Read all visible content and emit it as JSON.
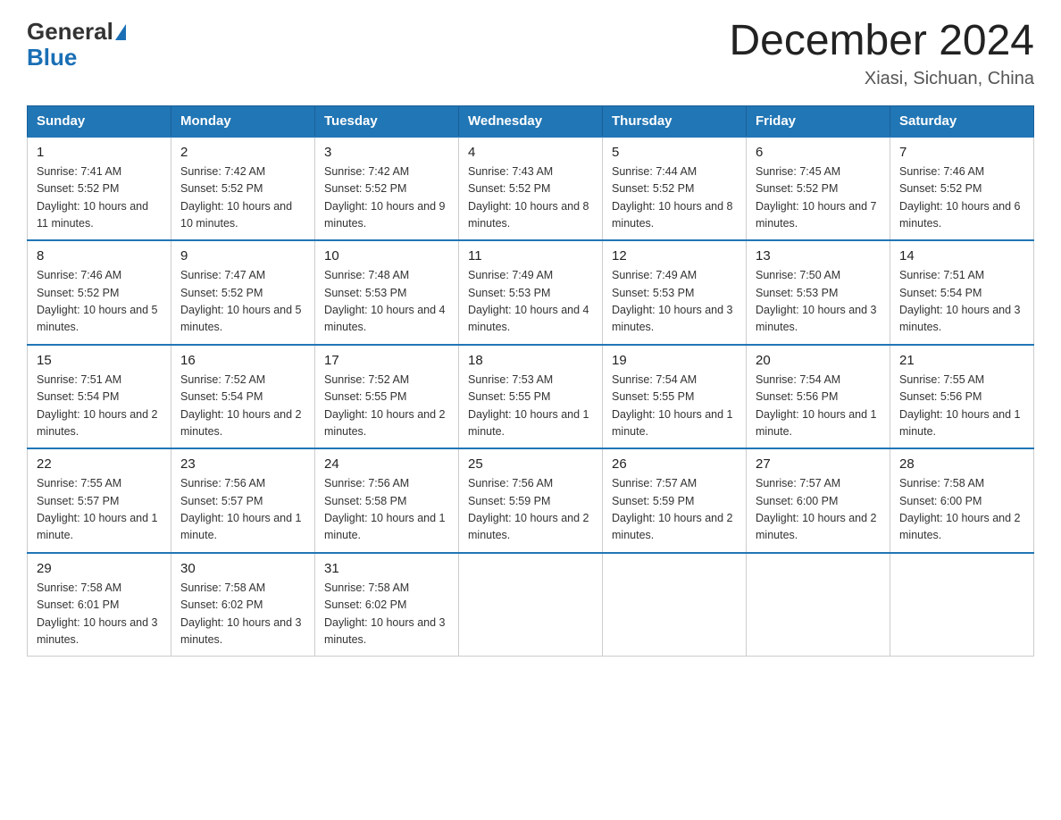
{
  "header": {
    "logo_general": "General",
    "logo_blue": "Blue",
    "month_year": "December 2024",
    "location": "Xiasi, Sichuan, China"
  },
  "weekdays": [
    "Sunday",
    "Monday",
    "Tuesday",
    "Wednesday",
    "Thursday",
    "Friday",
    "Saturday"
  ],
  "weeks": [
    [
      {
        "day": "1",
        "sunrise": "7:41 AM",
        "sunset": "5:52 PM",
        "daylight": "10 hours and 11 minutes."
      },
      {
        "day": "2",
        "sunrise": "7:42 AM",
        "sunset": "5:52 PM",
        "daylight": "10 hours and 10 minutes."
      },
      {
        "day": "3",
        "sunrise": "7:42 AM",
        "sunset": "5:52 PM",
        "daylight": "10 hours and 9 minutes."
      },
      {
        "day": "4",
        "sunrise": "7:43 AM",
        "sunset": "5:52 PM",
        "daylight": "10 hours and 8 minutes."
      },
      {
        "day": "5",
        "sunrise": "7:44 AM",
        "sunset": "5:52 PM",
        "daylight": "10 hours and 8 minutes."
      },
      {
        "day": "6",
        "sunrise": "7:45 AM",
        "sunset": "5:52 PM",
        "daylight": "10 hours and 7 minutes."
      },
      {
        "day": "7",
        "sunrise": "7:46 AM",
        "sunset": "5:52 PM",
        "daylight": "10 hours and 6 minutes."
      }
    ],
    [
      {
        "day": "8",
        "sunrise": "7:46 AM",
        "sunset": "5:52 PM",
        "daylight": "10 hours and 5 minutes."
      },
      {
        "day": "9",
        "sunrise": "7:47 AM",
        "sunset": "5:52 PM",
        "daylight": "10 hours and 5 minutes."
      },
      {
        "day": "10",
        "sunrise": "7:48 AM",
        "sunset": "5:53 PM",
        "daylight": "10 hours and 4 minutes."
      },
      {
        "day": "11",
        "sunrise": "7:49 AM",
        "sunset": "5:53 PM",
        "daylight": "10 hours and 4 minutes."
      },
      {
        "day": "12",
        "sunrise": "7:49 AM",
        "sunset": "5:53 PM",
        "daylight": "10 hours and 3 minutes."
      },
      {
        "day": "13",
        "sunrise": "7:50 AM",
        "sunset": "5:53 PM",
        "daylight": "10 hours and 3 minutes."
      },
      {
        "day": "14",
        "sunrise": "7:51 AM",
        "sunset": "5:54 PM",
        "daylight": "10 hours and 3 minutes."
      }
    ],
    [
      {
        "day": "15",
        "sunrise": "7:51 AM",
        "sunset": "5:54 PM",
        "daylight": "10 hours and 2 minutes."
      },
      {
        "day": "16",
        "sunrise": "7:52 AM",
        "sunset": "5:54 PM",
        "daylight": "10 hours and 2 minutes."
      },
      {
        "day": "17",
        "sunrise": "7:52 AM",
        "sunset": "5:55 PM",
        "daylight": "10 hours and 2 minutes."
      },
      {
        "day": "18",
        "sunrise": "7:53 AM",
        "sunset": "5:55 PM",
        "daylight": "10 hours and 1 minute."
      },
      {
        "day": "19",
        "sunrise": "7:54 AM",
        "sunset": "5:55 PM",
        "daylight": "10 hours and 1 minute."
      },
      {
        "day": "20",
        "sunrise": "7:54 AM",
        "sunset": "5:56 PM",
        "daylight": "10 hours and 1 minute."
      },
      {
        "day": "21",
        "sunrise": "7:55 AM",
        "sunset": "5:56 PM",
        "daylight": "10 hours and 1 minute."
      }
    ],
    [
      {
        "day": "22",
        "sunrise": "7:55 AM",
        "sunset": "5:57 PM",
        "daylight": "10 hours and 1 minute."
      },
      {
        "day": "23",
        "sunrise": "7:56 AM",
        "sunset": "5:57 PM",
        "daylight": "10 hours and 1 minute."
      },
      {
        "day": "24",
        "sunrise": "7:56 AM",
        "sunset": "5:58 PM",
        "daylight": "10 hours and 1 minute."
      },
      {
        "day": "25",
        "sunrise": "7:56 AM",
        "sunset": "5:59 PM",
        "daylight": "10 hours and 2 minutes."
      },
      {
        "day": "26",
        "sunrise": "7:57 AM",
        "sunset": "5:59 PM",
        "daylight": "10 hours and 2 minutes."
      },
      {
        "day": "27",
        "sunrise": "7:57 AM",
        "sunset": "6:00 PM",
        "daylight": "10 hours and 2 minutes."
      },
      {
        "day": "28",
        "sunrise": "7:58 AM",
        "sunset": "6:00 PM",
        "daylight": "10 hours and 2 minutes."
      }
    ],
    [
      {
        "day": "29",
        "sunrise": "7:58 AM",
        "sunset": "6:01 PM",
        "daylight": "10 hours and 3 minutes."
      },
      {
        "day": "30",
        "sunrise": "7:58 AM",
        "sunset": "6:02 PM",
        "daylight": "10 hours and 3 minutes."
      },
      {
        "day": "31",
        "sunrise": "7:58 AM",
        "sunset": "6:02 PM",
        "daylight": "10 hours and 3 minutes."
      },
      null,
      null,
      null,
      null
    ]
  ]
}
